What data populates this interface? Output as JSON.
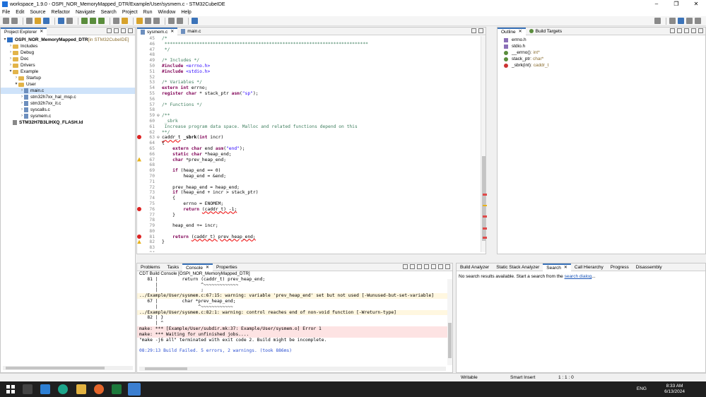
{
  "window": {
    "title": "workspace_1.9.0 - OSPI_NOR_MemoryMapped_DTR/Example/User/sysmem.c - STM32CubeIDE",
    "controls": [
      "–",
      "❐",
      "✕"
    ]
  },
  "menu": [
    "File",
    "Edit",
    "Source",
    "Refactor",
    "Navigate",
    "Search",
    "Project",
    "Run",
    "Window",
    "Help"
  ],
  "explorer": {
    "tab": "Project Explorer",
    "items": [
      {
        "label": "OSPI_NOR_MemoryMapped_DTR",
        "suffix": " [in STM32CubeIDE]",
        "depth": 0,
        "kind": "project",
        "arrow": "▾"
      },
      {
        "label": "Includes",
        "depth": 1,
        "kind": "folder",
        "arrow": "›"
      },
      {
        "label": "Debug",
        "depth": 1,
        "kind": "folder",
        "arrow": "›"
      },
      {
        "label": "Doc",
        "depth": 1,
        "kind": "folder",
        "arrow": "›"
      },
      {
        "label": "Drivers",
        "depth": 1,
        "kind": "folder",
        "arrow": "›"
      },
      {
        "label": "Example",
        "depth": 1,
        "kind": "folder",
        "arrow": "▾"
      },
      {
        "label": "Startup",
        "depth": 2,
        "kind": "folder",
        "arrow": "›"
      },
      {
        "label": "User",
        "depth": 2,
        "kind": "folder",
        "arrow": "▾"
      },
      {
        "label": "main.c",
        "depth": 3,
        "kind": "file",
        "arrow": "›"
      },
      {
        "label": "stm32h7xx_hal_msp.c",
        "depth": 3,
        "kind": "file",
        "arrow": "›"
      },
      {
        "label": "stm32h7xx_it.c",
        "depth": 3,
        "kind": "file",
        "arrow": "›"
      },
      {
        "label": "syscalls.c",
        "depth": 3,
        "kind": "file",
        "arrow": "›"
      },
      {
        "label": "sysmem.c",
        "depth": 3,
        "kind": "file",
        "arrow": "›"
      },
      {
        "label": "STM32H7B3LIHXQ_FLASH.ld",
        "depth": 1,
        "kind": "ld",
        "arrow": ""
      }
    ]
  },
  "editor": {
    "tabs": [
      {
        "label": "sysmem.c",
        "active": true
      },
      {
        "label": "main.c",
        "active": false
      }
    ],
    "lines": [
      {
        "n": "45",
        "html": "<span class=\"cm\">/*</span>"
      },
      {
        "n": "46",
        "html": "<span class=\"cm\"> ****************************************************************************</span>"
      },
      {
        "n": "47",
        "html": "<span class=\"cm\"> */</span>"
      },
      {
        "n": "48",
        "html": ""
      },
      {
        "n": "49",
        "html": "<span class=\"cm\">/* Includes */</span>"
      },
      {
        "n": "50",
        "html": "<span class=\"pp\">#include</span> <span class=\"str\">&lt;errno.h&gt;</span>"
      },
      {
        "n": "51",
        "html": "<span class=\"pp\">#include</span> <span class=\"str\">&lt;stdio.h&gt;</span>"
      },
      {
        "n": "52",
        "html": ""
      },
      {
        "n": "53",
        "html": "<span class=\"cm\">/* Variables */</span>"
      },
      {
        "n": "54",
        "html": "<span class=\"kw\">extern int</span> errno;"
      },
      {
        "n": "55",
        "html": "<span class=\"kw\">register char</span> * stack_ptr <span class=\"kw\">asm</span>(<span class=\"str\">\"sp\"</span>);"
      },
      {
        "n": "56",
        "html": ""
      },
      {
        "n": "57",
        "html": "<span class=\"cm\">/* Functions */</span>"
      },
      {
        "n": "58",
        "html": ""
      },
      {
        "n": "59",
        "fold": "⊖",
        "html": "<span class=\"cm\">/**</span>"
      },
      {
        "n": "60",
        "html": "<span class=\"cm\"> _sbrk</span>"
      },
      {
        "n": "61",
        "html": "<span class=\"cm\"> Increase program data space. Malloc and related functions depend on this</span>"
      },
      {
        "n": "62",
        "html": "<span class=\"cm\">**/</span>"
      },
      {
        "n": "63",
        "mark": "err",
        "fold": "⊖",
        "html": "<span class=\"err\">caddr_t</span> <b>_sbrk</b>(<span class=\"kw\">int</span> incr)"
      },
      {
        "n": "64",
        "html": "{"
      },
      {
        "n": "65",
        "html": "    <span class=\"kw\">extern char</span> end <span class=\"kw\">asm</span>(<span class=\"str\">\"end\"</span>);"
      },
      {
        "n": "66",
        "html": "    <span class=\"kw\">static char</span> *heap_end;"
      },
      {
        "n": "67",
        "mark": "warn",
        "html": "    <span class=\"kw\">char</span> *prev_heap_end;"
      },
      {
        "n": "68",
        "html": ""
      },
      {
        "n": "69",
        "html": "    <span class=\"kw\">if</span> (heap_end == 0)"
      },
      {
        "n": "70",
        "html": "        heap_end = &amp;end;"
      },
      {
        "n": "71",
        "html": ""
      },
      {
        "n": "72",
        "html": "    prev_heap_end = heap_end;"
      },
      {
        "n": "73",
        "html": "    <span class=\"kw\">if</span> (heap_end + incr &gt; stack_ptr)"
      },
      {
        "n": "74",
        "html": "    {"
      },
      {
        "n": "75",
        "html": "        errno = ENOMEM;"
      },
      {
        "n": "76",
        "mark": "err",
        "html": "        <span class=\"kw\">return</span> <span class=\"err\">(caddr_t) -1;</span>"
      },
      {
        "n": "77",
        "html": "    }"
      },
      {
        "n": "78",
        "html": ""
      },
      {
        "n": "79",
        "html": "    heap_end += incr;"
      },
      {
        "n": "80",
        "html": ""
      },
      {
        "n": "81",
        "mark": "err",
        "html": "    <span class=\"kw\">return</span> <span class=\"err\">(caddr_t) prev_heap_end;</span>"
      },
      {
        "n": "82",
        "mark": "warn",
        "html": "}"
      },
      {
        "n": "83",
        "html": ""
      },
      {
        "n": "84",
        "html": ""
      }
    ]
  },
  "outline": {
    "tabs": [
      {
        "label": "Outline",
        "active": true
      },
      {
        "label": "Build Targets",
        "active": false
      }
    ],
    "items": [
      {
        "kind": "inc",
        "name": "errno.h",
        "type": ""
      },
      {
        "kind": "inc",
        "name": "stdio.h",
        "type": ""
      },
      {
        "kind": "var",
        "name": "__errno() ",
        "type": ": int*"
      },
      {
        "kind": "var",
        "name": "stack_ptr ",
        "type": ": char*"
      },
      {
        "kind": "fn",
        "name": "_sbrk(int) ",
        "type": ": caddr_t"
      }
    ]
  },
  "console": {
    "tabs": [
      {
        "label": "Problems"
      },
      {
        "label": "Tasks"
      },
      {
        "label": "Console",
        "active": true
      },
      {
        "label": "Properties"
      }
    ],
    "header": "CDT Build Console [OSPI_NOR_MemoryMapped_DTR]",
    "lines": [
      {
        "text": "   81 |         return (caddr_t) prev_heap_end;",
        "cls": ""
      },
      {
        "text": "      |                ^~~~~~~~~~~~~~",
        "cls": ""
      },
      {
        "text": "      |                ;",
        "cls": ""
      },
      {
        "text": "../Example/User/sysmem.c:67:15: warning: variable 'prev_heap_end' set but not used [-Wunused-but-set-variable]",
        "cls": "warnbg"
      },
      {
        "text": "   67 |         char *prev_heap_end;",
        "cls": ""
      },
      {
        "text": "      |               ^~~~~~~~~~~~~",
        "cls": ""
      },
      {
        "text": "../Example/User/sysmem.c:82:1: warning: control reaches end of non-void function [-Wreturn-type]",
        "cls": "warnbg"
      },
      {
        "text": "   82 | }",
        "cls": ""
      },
      {
        "text": "      | ^",
        "cls": ""
      },
      {
        "text": "make: *** [Example/User/subdir.mk:37: Example/User/sysmem.o] Error 1",
        "cls": "errbg"
      },
      {
        "text": "make: *** Waiting for unfinished jobs....",
        "cls": "errbg"
      },
      {
        "text": "\"make -j6 all\" terminated with exit code 2. Build might be incomplete.",
        "cls": ""
      },
      {
        "text": "",
        "cls": ""
      },
      {
        "text": "08:29:13 Build Failed. 5 errors, 2 warnings. (took 886ms)",
        "cls": "blue"
      }
    ]
  },
  "search": {
    "tabs": [
      {
        "label": "Build Analyzer"
      },
      {
        "label": "Static Stack Analyzer"
      },
      {
        "label": "Search",
        "active": true
      },
      {
        "label": "Call Hierarchy"
      },
      {
        "label": "Progress"
      },
      {
        "label": "Disassembly"
      }
    ],
    "message": "No search results available. Start a search from the ",
    "link": "search dialog",
    "suffix": "..."
  },
  "status": {
    "mode": "Writable",
    "insert": "Smart Insert",
    "position": "1 : 1 : 0"
  },
  "taskbar": {
    "lang": "ENG",
    "time": "8:33 AM",
    "date": "6/13/2024"
  },
  "colors": {
    "accent": "#3b73b9",
    "error": "#d22222",
    "warning": "#e8b21a"
  }
}
